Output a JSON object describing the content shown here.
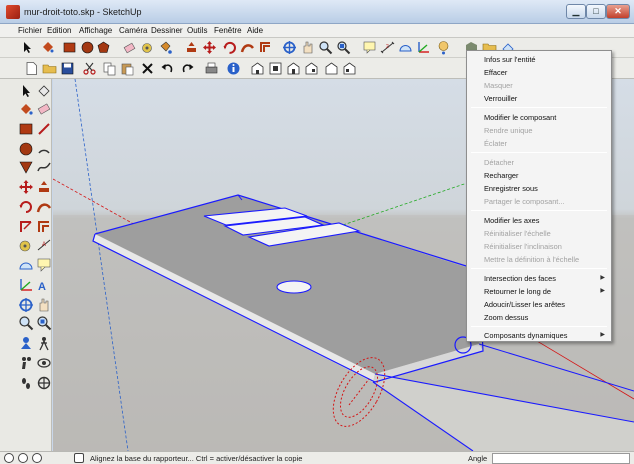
{
  "window": {
    "title": "mur-droit-toto.skp - SketchUp",
    "minimize": "▁",
    "maximize": "□",
    "close": "✕"
  },
  "menubar": {
    "items": [
      "Fichier",
      "Edition",
      "Affichage",
      "Caméra",
      "Dessiner",
      "Outils",
      "Fenêtre",
      "Aide"
    ]
  },
  "context_menu": {
    "items": [
      {
        "label": "Infos sur l'entité",
        "enabled": true,
        "submenu": false
      },
      {
        "label": "Effacer",
        "enabled": true,
        "submenu": false
      },
      {
        "label": "Masquer",
        "enabled": false,
        "submenu": false
      },
      {
        "label": "Verrouiller",
        "enabled": true,
        "submenu": false
      },
      {
        "label": "Modifier le composant",
        "enabled": true,
        "submenu": false
      },
      {
        "label": "Rendre unique",
        "enabled": false,
        "submenu": false
      },
      {
        "label": "Éclater",
        "enabled": false,
        "submenu": false
      },
      {
        "label": "Détacher",
        "enabled": false,
        "submenu": false
      },
      {
        "label": "Recharger",
        "enabled": true,
        "submenu": false
      },
      {
        "label": "Enregistrer sous",
        "enabled": true,
        "submenu": false
      },
      {
        "label": "Partager le composant...",
        "enabled": false,
        "submenu": false
      },
      {
        "label": "Modifier les axes",
        "enabled": true,
        "submenu": false
      },
      {
        "label": "Réinitialiser l'échelle",
        "enabled": false,
        "submenu": false
      },
      {
        "label": "Réinitialiser l'inclinaison",
        "enabled": false,
        "submenu": false
      },
      {
        "label": "Mettre la définition à l'échelle",
        "enabled": false,
        "submenu": false
      },
      {
        "label": "Intersection des faces",
        "enabled": true,
        "submenu": true
      },
      {
        "label": "Retourner le long de",
        "enabled": true,
        "submenu": true
      },
      {
        "label": "Adoucir/Lisser les arêtes",
        "enabled": true,
        "submenu": false
      },
      {
        "label": "Zoom dessus",
        "enabled": true,
        "submenu": false
      },
      {
        "label": "Composants dynamiques",
        "enabled": true,
        "submenu": true
      }
    ]
  },
  "statusbar": {
    "hint": "Alignez la base du rapporteur... Ctrl = activer/désactiver la copie",
    "measure_label": "Angle",
    "measure_value": ""
  },
  "icons": {
    "toolbar1": [
      "select-icon",
      "paint-bucket-icon",
      "rectangle-icon",
      "circle-icon",
      "polygon-icon",
      "eraser-icon",
      "tape-measure-icon",
      "push-pull-icon",
      "move-icon",
      "rotate-icon",
      "follow-me-icon",
      "scale-icon",
      "offset-icon",
      "orbit-icon",
      "pan-icon",
      "zoom-icon",
      "zoom-window-icon",
      "zoom-extents-icon",
      "previous-view-icon",
      "text-icon",
      "dimension-icon",
      "protractor-icon",
      "axes-icon",
      "3d-text-icon",
      "section-plane-icon",
      "walk-icon",
      "position-camera-icon",
      "look-around-icon",
      "shadows-icon",
      "folder-icon",
      "components-icon"
    ],
    "toolbar2": [
      "new-icon",
      "open-icon",
      "save-icon",
      "cut-icon",
      "copy-icon",
      "paste-icon",
      "erase-icon",
      "undo-icon",
      "redo-icon",
      "print-icon",
      "model-info-icon",
      "iso-view-icon",
      "top-view-icon",
      "front-view-icon",
      "right-view-icon",
      "back-view-icon",
      "left-view-icon"
    ]
  },
  "colors": {
    "selection": "#1a1aff",
    "red_axis": "#d41515",
    "green_axis": "#22aa22",
    "face": "#9e9e9e"
  }
}
